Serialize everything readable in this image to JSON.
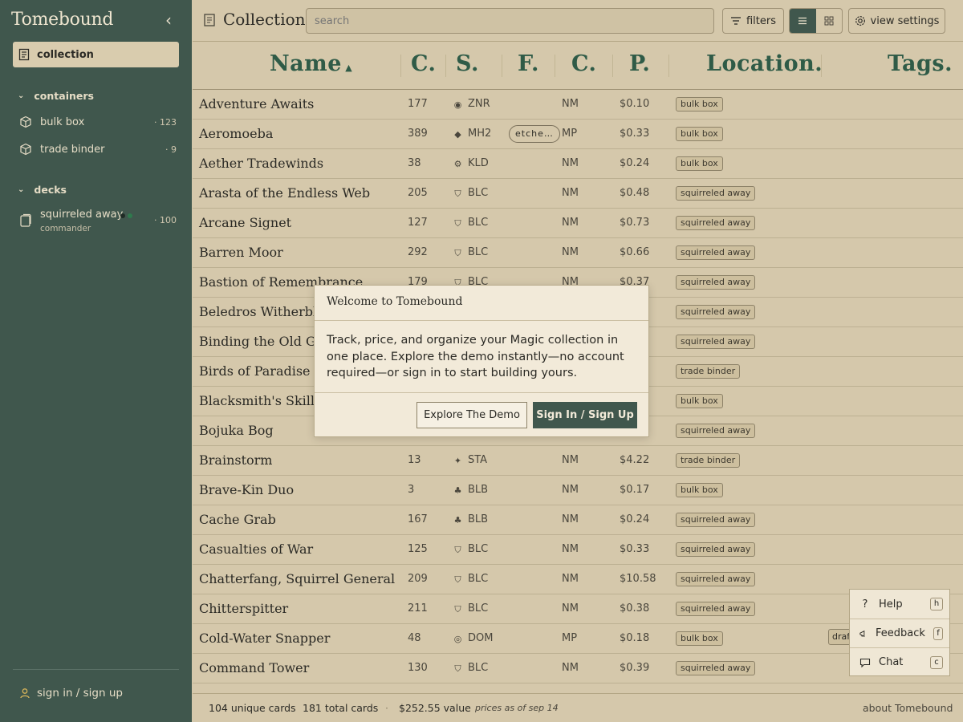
{
  "sidebar": {
    "brand": "Tomebound",
    "collection_label": "collection",
    "containers_heading": "containers",
    "containers": [
      {
        "label": "bulk box",
        "count": "· 123"
      },
      {
        "label": "trade binder",
        "count": "· 9"
      }
    ],
    "decks_heading": "decks",
    "deck": {
      "label": "squirreled away",
      "sub": "commander",
      "count": "· 100",
      "dot_colors": [
        "#1f2b25",
        "#2f7a4d"
      ]
    },
    "signin_label": "sign in / sign up"
  },
  "topbar": {
    "title": "Collection",
    "search_placeholder": "search",
    "filters_label": "filters",
    "view_settings_label": "view settings"
  },
  "table": {
    "headers": [
      "Name",
      "C",
      "S",
      "F",
      "C",
      "P",
      "Location",
      "Tags"
    ],
    "rows": [
      {
        "name": "Adventure Awaits",
        "num": "177",
        "set": "ZNR",
        "foil": "",
        "cond": "NM",
        "price": "$0.10",
        "loc": "bulk box"
      },
      {
        "name": "Aeromoeba",
        "num": "389",
        "set": "MH2",
        "foil": "etche…",
        "cond": "MP",
        "price": "$0.33",
        "loc": "bulk box"
      },
      {
        "name": "Aether Tradewinds",
        "num": "38",
        "set": "KLD",
        "foil": "",
        "cond": "NM",
        "price": "$0.24",
        "loc": "bulk box"
      },
      {
        "name": "Arasta of the Endless Web",
        "num": "205",
        "set": "BLC",
        "foil": "",
        "cond": "NM",
        "price": "$0.48",
        "loc": "squirreled away"
      },
      {
        "name": "Arcane Signet",
        "num": "127",
        "set": "BLC",
        "foil": "",
        "cond": "NM",
        "price": "$0.73",
        "loc": "squirreled away"
      },
      {
        "name": "Barren Moor",
        "num": "292",
        "set": "BLC",
        "foil": "",
        "cond": "NM",
        "price": "$0.66",
        "loc": "squirreled away"
      },
      {
        "name": "Bastion of Remembrance",
        "num": "179",
        "set": "BLC",
        "foil": "",
        "cond": "NM",
        "price": "$0.37",
        "loc": "squirreled away"
      },
      {
        "name": "Beledros Witherbloom",
        "num": "",
        "set": "",
        "foil": "",
        "cond": "",
        "price": "",
        "loc": "squirreled away"
      },
      {
        "name": "Binding the Old Gods",
        "num": "",
        "set": "",
        "foil": "",
        "cond": "",
        "price": "",
        "loc": "squirreled away"
      },
      {
        "name": "Birds of Paradise",
        "num": "",
        "set": "",
        "foil": "",
        "cond": "",
        "price": "",
        "loc": "trade binder"
      },
      {
        "name": "Blacksmith's Skill",
        "num": "",
        "set": "",
        "foil": "",
        "cond": "",
        "price": "",
        "loc": "bulk box"
      },
      {
        "name": "Bojuka Bog",
        "num": "",
        "set": "",
        "foil": "",
        "cond": "",
        "price": "",
        "loc": "squirreled away"
      },
      {
        "name": "Brainstorm",
        "num": "13",
        "set": "STA",
        "foil": "",
        "cond": "NM",
        "price": "$4.22",
        "loc": "trade binder"
      },
      {
        "name": "Brave-Kin Duo",
        "num": "3",
        "set": "BLB",
        "foil": "",
        "cond": "NM",
        "price": "$0.17",
        "loc": "bulk box"
      },
      {
        "name": "Cache Grab",
        "num": "167",
        "set": "BLB",
        "foil": "",
        "cond": "NM",
        "price": "$0.24",
        "loc": "squirreled away"
      },
      {
        "name": "Casualties of War",
        "num": "125",
        "set": "BLC",
        "foil": "",
        "cond": "NM",
        "price": "$0.33",
        "loc": "squirreled away"
      },
      {
        "name": "Chatterfang, Squirrel General",
        "num": "209",
        "set": "BLC",
        "foil": "",
        "cond": "NM",
        "price": "$10.58",
        "loc": "squirreled away"
      },
      {
        "name": "Chitterspitter",
        "num": "211",
        "set": "BLC",
        "foil": "",
        "cond": "NM",
        "price": "$0.38",
        "loc": "squirreled away"
      },
      {
        "name": "Cold-Water Snapper",
        "num": "48",
        "set": "DOM",
        "foil": "",
        "cond": "MP",
        "price": "$0.18",
        "loc": "bulk box"
      },
      {
        "name": "Command Tower",
        "num": "130",
        "set": "BLC",
        "foil": "",
        "cond": "NM",
        "price": "$0.39",
        "loc": "squirreled away"
      }
    ],
    "partial_tag": "draft"
  },
  "modal": {
    "title": "Welcome to Tomebound",
    "body": "Track, price, and organize your Magic collection in one place. Explore the demo instantly—no account required—or sign in to start building yours.",
    "demo_label": "Explore The Demo",
    "signin_label": "Sign In / Sign Up"
  },
  "help_menu": {
    "items": [
      {
        "label": "Help",
        "key": "h",
        "icon": "question-icon"
      },
      {
        "label": "Feedback",
        "key": "f",
        "icon": "megaphone-icon"
      },
      {
        "label": "Chat",
        "key": "c",
        "icon": "chat-icon"
      }
    ]
  },
  "footer": {
    "unique": "104 unique cards",
    "total": "181 total cards",
    "value": "$252.55 value",
    "prices_as_of": "prices as of sep 14",
    "about": "about Tomebound"
  },
  "colors": {
    "sidebar_bg": "#40574d",
    "page_bg": "#d5c8ab",
    "header_green": "#2f5b47",
    "accent_button": "#40574d"
  }
}
